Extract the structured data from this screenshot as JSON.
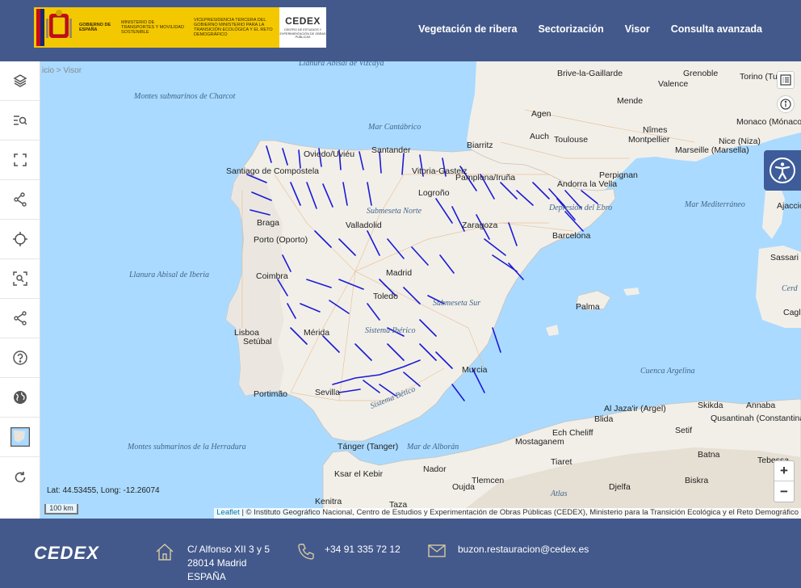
{
  "header": {
    "gob_text": "GOBIERNO DE ESPAÑA",
    "ministry_text": "MINISTERIO DE TRANSPORTES Y MOVILIDAD SOSTENIBLE",
    "vice_text": "VICEPRESIDENCIA TERCERA DEL GOBIERNO MINISTERIO PARA LA TRANSICIÓN ECOLÓGICA Y EL RETO DEMOGRÁFICO",
    "cedex_logo": "CEDEX",
    "cedex_sub": "CENTRO DE ESTUDIOS Y EXPERIMENTACIÓN DE OBRAS PÚBLICAS",
    "nav": [
      "Vegetación de ribera",
      "Sectorización",
      "Visor",
      "Consulta avanzada"
    ]
  },
  "breadcrumb": {
    "home": "icio",
    "sep": ">",
    "current": "Visor"
  },
  "map": {
    "coords": "Lat: 44.53455, Long: -12.26074",
    "scale": "100 km",
    "attribution_link": "Leaflet",
    "attribution_text": "| © Instituto Geográfico Nacional, Centro de Estudios y Experimentación de Obras Públicas (CEDEX), Ministerio para la Transición Ecológica y el Reto Demográfico",
    "zoom_in": "+",
    "zoom_out": "−",
    "seas": [
      "Llanura Abisal de Vizcaya",
      "Montes submarinos de Charcot",
      "Mar Cantábrico",
      "Llanura Abisal de Iberia",
      "Montes submarinos de la Herradura",
      "Mar de Alborán",
      "Mar Mediterráneo",
      "Cuenca Argelina",
      "Atlas",
      "Submeseta Sur",
      "Submeseta Norte",
      "Sistema Ibérico",
      "Sistema Bético",
      "Depresión del Ebro",
      "Cerd"
    ],
    "cities": [
      "Brive-la-Gaillarde",
      "Grenoble",
      "Torino (Turin)",
      "Valence",
      "Mende",
      "Agen",
      "Nîmes",
      "Montpellier",
      "Auch",
      "Toulouse",
      "Marseille (Marsella)",
      "Nice (Niza)",
      "Monaco (Mónaco)",
      "Biarritz",
      "Perpignan",
      "Andorra la Vella",
      "Ajaccio",
      "Oviedo/Uviéu",
      "Santander",
      "Vitoria-Gasteiz",
      "Pamplona/Iruña",
      "Logroño",
      "Santiago de Compostela",
      "Braga",
      "Valladolid",
      "Zaragoza",
      "Barcelona",
      "Porto (Oporto)",
      "Coimbra",
      "Madrid",
      "Toledo",
      "Palma",
      "Lisboa",
      "Setúbal",
      "Mérida",
      "Murcia",
      "Portimão",
      "Sevilla",
      "Tánger (Tanger)",
      "Ksar el Kebir",
      "Kenitra",
      "Taza",
      "Nador",
      "Oujda",
      "Tlemcen",
      "Djelfa",
      "Tiaret",
      "Ech Cheliff",
      "Mostaganem",
      "Al Jaza'ir (Argel)",
      "Blida",
      "Setif",
      "Batna",
      "Biskra",
      "Skikda",
      "Annaba",
      "Qusantinah (Constantina)",
      "Tebessa",
      "Sassari",
      "Cagli"
    ]
  },
  "footer": {
    "logo": "CEDEX",
    "address": [
      "C/ Alfonso XII 3 y 5",
      "28014 Madrid",
      "ESPAÑA"
    ],
    "phone": "+34 91 335 72 12",
    "email": "buzon.restauracion@cedex.es"
  },
  "colors": {
    "header_bg": "#43598c",
    "sea": "#aadaff",
    "land": "#f2efe9",
    "river": "#1a1ad6",
    "accent": "#3d5c99"
  }
}
